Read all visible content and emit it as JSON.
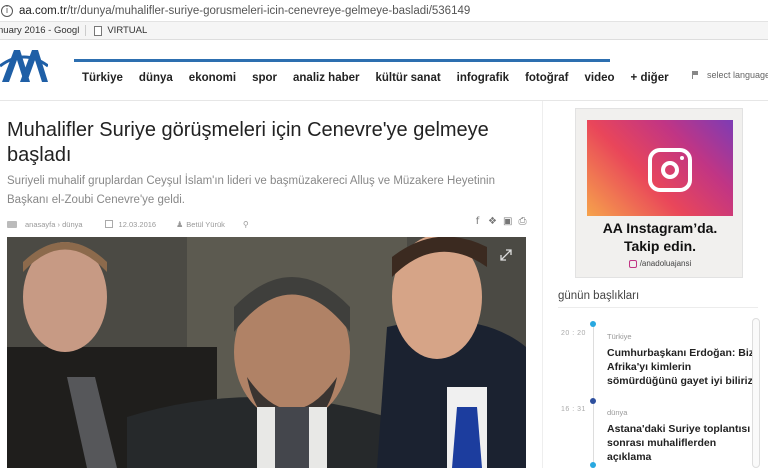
{
  "browser": {
    "info_icon": "info-icon",
    "url_domain": "aa.com.tr",
    "url_path": "/tr/dunya/muhalifler-suriye-gorusmeleri-icin-cenevreye-gelmeye-basladi/536149",
    "bookmark_1": "nuary 2016 - Googl",
    "bookmark_2": "VIRTUAL"
  },
  "header": {
    "logo": "AA",
    "nav": [
      "Türkiye",
      "dünya",
      "ekonomi",
      "spor",
      "analiz haber",
      "kültür sanat",
      "infografik",
      "fotoğraf",
      "video",
      "+ diğer"
    ],
    "select_language": "select language",
    "accent": "#2d6fb0"
  },
  "article": {
    "title": "Muhalifler Suriye görüşmeleri için Cenevre'ye gelmeye başladı",
    "lead": "Suriyeli muhalif gruplardan Ceyşul İslam'ın lideri ve başmüzakereci Alluş ve Müzakere Heyetinin Başkanı el-Zoubi Cenevre'ye geldi.",
    "breadcrumb": "anasayfa › dünya",
    "date": "12.03.2016",
    "author": "Betül Yürük",
    "share_icons": [
      "facebook-icon",
      "twitter-icon",
      "linkedin-icon",
      "print-icon"
    ]
  },
  "sidebar": {
    "instagram": {
      "promo_line1": "AA Instagram’da.",
      "promo_line2": "Takip edin.",
      "handle": "/anadoluajansi"
    },
    "section_title": "günün başlıkları",
    "items": [
      {
        "time": "20 : 20",
        "category": "Türkiye",
        "headline": "Cumhurbaşkanı Erdoğan: Biz Afrika'yı kimlerin sömürdüğünü gayet iyi biliriz",
        "dot_color": "#29a8e0"
      },
      {
        "time": "16 : 31",
        "category": "dünya",
        "headline": "Astana'daki Suriye toplantısı sonrası muhaliflerden açıklama",
        "dot_color": "#2d4f9e"
      }
    ]
  }
}
